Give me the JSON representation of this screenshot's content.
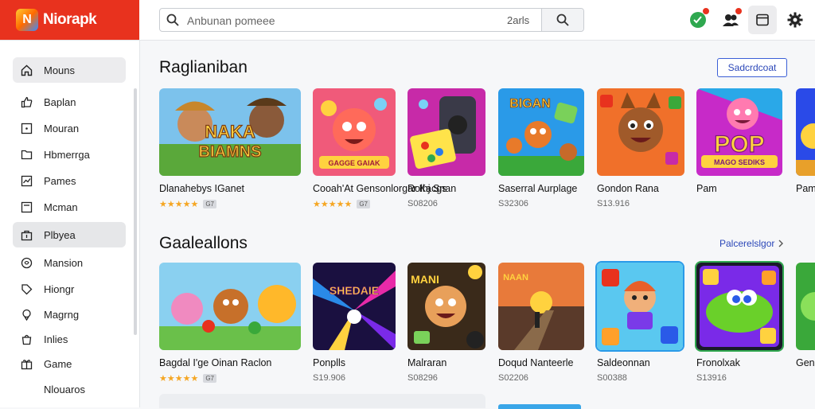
{
  "app": {
    "name": "Niorapk",
    "logo_glyph": "N"
  },
  "search": {
    "placeholder": "Anbunan pomeee",
    "filter": "2arls"
  },
  "sidebar": {
    "items": [
      {
        "label": "Mouns",
        "icon": "home-icon"
      },
      {
        "label": "Baplan",
        "icon": "thumbs-up-icon"
      },
      {
        "label": "Mouran",
        "icon": "square-icon"
      },
      {
        "label": "Hbmerrga",
        "icon": "folder-icon"
      },
      {
        "label": "Pames",
        "icon": "chart-icon"
      },
      {
        "label": "Mcman",
        "icon": "bookmark-icon"
      },
      {
        "label": "Plbyea",
        "icon": "bag-icon"
      },
      {
        "label": "Mansion",
        "icon": "heart-icon"
      },
      {
        "label": "Hiongr",
        "icon": "tag-icon"
      },
      {
        "label": "Magrng",
        "icon": "map-pin-icon"
      },
      {
        "label": "Inlies",
        "icon": "bag-icon"
      },
      {
        "label": "Game",
        "icon": "gift-icon"
      },
      {
        "label": "Nlouaros",
        "icon": ""
      }
    ]
  },
  "sections": [
    {
      "title": "Raglianiban",
      "action": "Sadcrdcoat",
      "cards": [
        {
          "title": "Dlanahebys IGanet",
          "meta": "",
          "stars": "★★★★★",
          "badge": "G7"
        },
        {
          "title": "Cooah'At Gensonlorgar Kacgs",
          "meta": "",
          "stars": "★★★★★",
          "badge": "G7"
        },
        {
          "title": "Rolhj Snan",
          "meta": "S08206",
          "stars": "",
          "badge": ""
        },
        {
          "title": "Saserral Aurplage",
          "meta": "S32306",
          "stars": "",
          "badge": ""
        },
        {
          "title": "Gondon Rana",
          "meta": "S13.916",
          "stars": "",
          "badge": ""
        },
        {
          "title": "Pam",
          "meta": "",
          "stars": "",
          "badge": ""
        }
      ]
    },
    {
      "title": "Gaaleallons",
      "action": "Palcerelslgor",
      "cards": [
        {
          "title": "Bagdal I'ge Oinan Raclon",
          "meta": "",
          "stars": "★★★★★",
          "badge": "G7"
        },
        {
          "title": "Ponplls",
          "meta": "S19.906",
          "stars": "",
          "badge": ""
        },
        {
          "title": "Malraran",
          "meta": "S08296",
          "stars": "",
          "badge": ""
        },
        {
          "title": "Doqud Nanteerle",
          "meta": "S02206",
          "stars": "",
          "badge": ""
        },
        {
          "title": "Saldeonnan",
          "meta": "S00388",
          "stars": "",
          "badge": ""
        },
        {
          "title": "Fronolxak",
          "meta": "S13916",
          "stars": "",
          "badge": ""
        },
        {
          "title": "Gen",
          "meta": "",
          "stars": "",
          "badge": ""
        }
      ]
    }
  ],
  "thumb_texts": {
    "naka": "NAKA",
    "biamns": "BIAMNS",
    "gage": "GAGGE GAIAK",
    "bigan": "BIGAN",
    "pop": "POP",
    "mago": "MAGO SEDIKS",
    "shenaie": "SHEDAIE",
    "mani": "MANI",
    "naan": "NAAN"
  },
  "colors": {
    "accent": "#e8321e",
    "link": "#2b47b8",
    "star": "#f5a623"
  }
}
